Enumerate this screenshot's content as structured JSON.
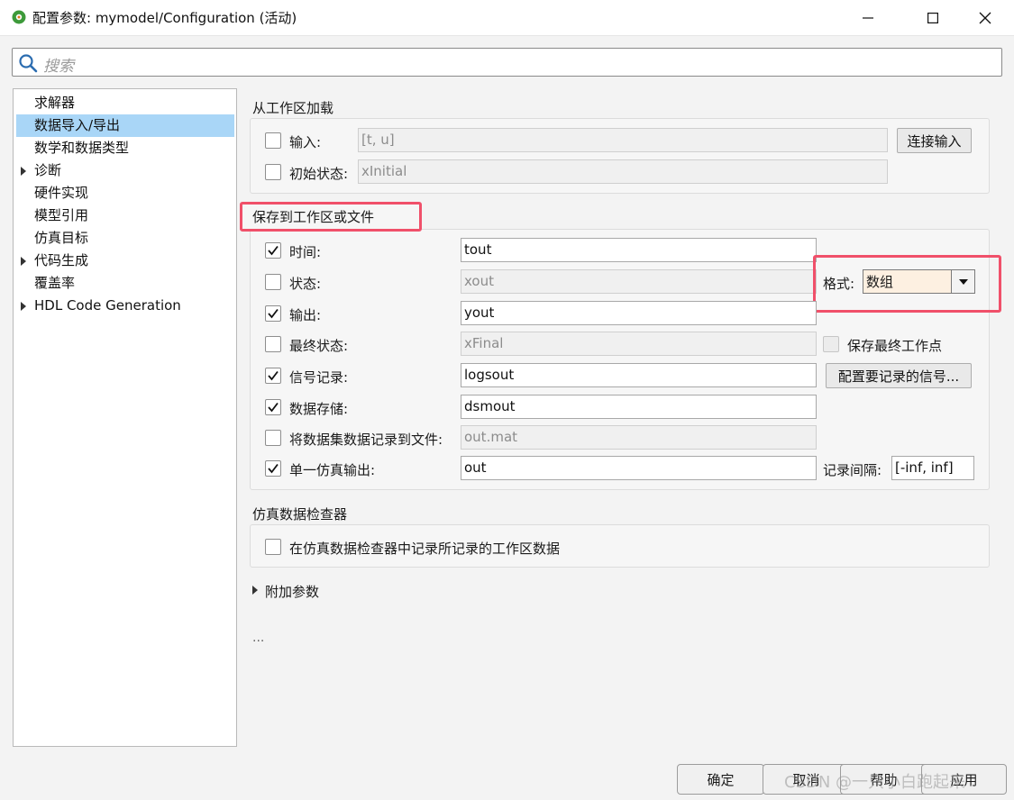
{
  "window": {
    "title": "配置参数: mymodel/Configuration (活动)",
    "icon": "simulink-gear-icon"
  },
  "search": {
    "placeholder": "搜索"
  },
  "tree": {
    "items": [
      {
        "label": "求解器",
        "expandable": false,
        "selected": false
      },
      {
        "label": "数据导入/导出",
        "expandable": false,
        "selected": true
      },
      {
        "label": "数学和数据类型",
        "expandable": false,
        "selected": false
      },
      {
        "label": "诊断",
        "expandable": true,
        "selected": false
      },
      {
        "label": "硬件实现",
        "expandable": false,
        "selected": false
      },
      {
        "label": "模型引用",
        "expandable": false,
        "selected": false
      },
      {
        "label": "仿真目标",
        "expandable": false,
        "selected": false
      },
      {
        "label": "代码生成",
        "expandable": true,
        "selected": false
      },
      {
        "label": "覆盖率",
        "expandable": false,
        "selected": false
      },
      {
        "label": "HDL Code Generation",
        "expandable": true,
        "selected": false
      }
    ]
  },
  "load_section": {
    "title": "从工作区加载",
    "input": {
      "label": "输入:",
      "value": "[t, u]",
      "checked": false
    },
    "initial_state": {
      "label": "初始状态:",
      "value": "xInitial",
      "checked": false
    },
    "connect_button": "连接输入"
  },
  "save_section": {
    "title": "保存到工作区或文件",
    "rows": [
      {
        "label": "时间:",
        "value": "tout",
        "checked": true,
        "enabled": true
      },
      {
        "label": "状态:",
        "value": "xout",
        "checked": false,
        "enabled": false
      },
      {
        "label": "输出:",
        "value": "yout",
        "checked": true,
        "enabled": true
      },
      {
        "label": "最终状态:",
        "value": "xFinal",
        "checked": false,
        "enabled": false
      },
      {
        "label": "信号记录:",
        "value": "logsout",
        "checked": true,
        "enabled": true
      },
      {
        "label": "数据存储:",
        "value": "dsmout",
        "checked": true,
        "enabled": true
      },
      {
        "label": "将数据集数据记录到文件:",
        "value": "out.mat",
        "checked": false,
        "enabled": false
      },
      {
        "label": "单一仿真输出:",
        "value": "out",
        "checked": true,
        "enabled": true
      }
    ],
    "format_label": "格式:",
    "format_value": "数组",
    "save_final_op_label": "保存最终工作点",
    "configure_signals_button": "配置要记录的信号...",
    "log_interval_label": "记录间隔:",
    "log_interval_value": "[-inf, inf]"
  },
  "sdi_section": {
    "title": "仿真数据检查器",
    "checkbox_label": "在仿真数据检查器中记录所记录的工作区数据"
  },
  "extra_params": {
    "label": "附加参数"
  },
  "ellipsis": "...",
  "buttons": {
    "ok": "确定",
    "cancel": "取消",
    "help": "帮助",
    "apply": "应用"
  },
  "watermark": "CSDN @一只小白跑起来",
  "colors": {
    "selection": "#a9d6f7",
    "highlight": "#f0506a",
    "dropdown_bg": "#fdf0e1"
  }
}
